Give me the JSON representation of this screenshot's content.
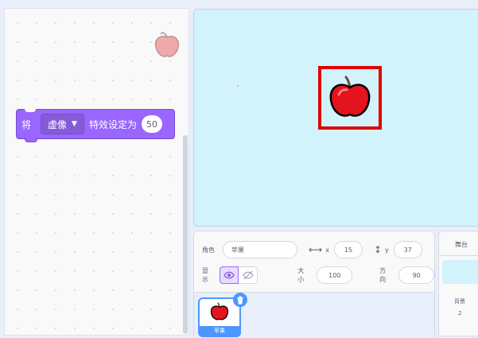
{
  "code": {
    "block": {
      "prefix": "将",
      "effect": "虚像",
      "suffix": "特效设定为",
      "value": "50"
    }
  },
  "sprite_info": {
    "sprite_label": "角色",
    "sprite_name": "苹果",
    "x_label": "x",
    "x_value": "15",
    "y_label": "y",
    "y_value": "37",
    "show_label": "显示",
    "size_label": "大小",
    "size_value": "100",
    "direction_label": "方向",
    "direction_value": "90"
  },
  "sprite_list": {
    "items": [
      {
        "name": "苹果",
        "selected": true
      }
    ]
  },
  "stage_panel": {
    "title": "舞台",
    "backdrops_label": "背景",
    "backdrops_count": "2"
  },
  "icons": [
    "apple-icon",
    "eye-icon",
    "eye-slash-icon",
    "trash-icon",
    "x-arrow-icon",
    "y-arrow-icon",
    "dropdown-caret-icon"
  ],
  "colors": {
    "looks_block": "#9966ff",
    "selection": "#4c97ff",
    "stage_bg": "#d2f2fc",
    "sprite_highlight": "#e00000"
  }
}
